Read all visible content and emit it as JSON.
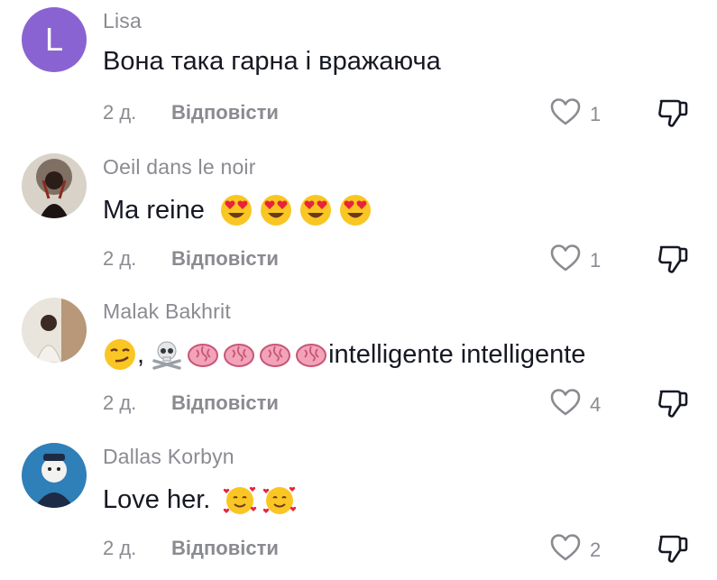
{
  "comments": [
    {
      "username": "Lisa",
      "avatar_letter": "L",
      "avatar_color": "#8a63d2",
      "text": "Вона така гарна і вражаюча",
      "emojis": [],
      "age": "2 д.",
      "reply_label": "Відповісти",
      "likes": "1"
    },
    {
      "username": "Oeil dans le noir",
      "text": "Ma reine",
      "emojis": [
        "heart-eyes-emoji",
        "heart-eyes-emoji",
        "heart-eyes-emoji",
        "heart-eyes-emoji"
      ],
      "age": "2 д.",
      "reply_label": "Відповісти",
      "likes": "1"
    },
    {
      "username": "Malak Bakhrit",
      "text_prefix": ",",
      "text": "intelligente intelligente",
      "emojis": [
        "smirk-emoji",
        "skull-crossbones-emoji",
        "brain-emoji",
        "brain-emoji",
        "brain-emoji",
        "brain-emoji"
      ],
      "age": "2 д.",
      "reply_label": "Відповісти",
      "likes": "4"
    },
    {
      "username": "Dallas Korbyn",
      "text": "Love her.",
      "emojis": [
        "smiling-hearts-emoji",
        "smiling-hearts-emoji"
      ],
      "age": "2 д.",
      "reply_label": "Відповісти",
      "likes": "2"
    }
  ],
  "icons": {
    "like": "heart-outline-icon",
    "dislike": "thumbs-down-icon"
  },
  "colors": {
    "muted_text": "#8a8b91",
    "primary_text": "#161823",
    "avatar_lisa": "#8a63d2"
  }
}
